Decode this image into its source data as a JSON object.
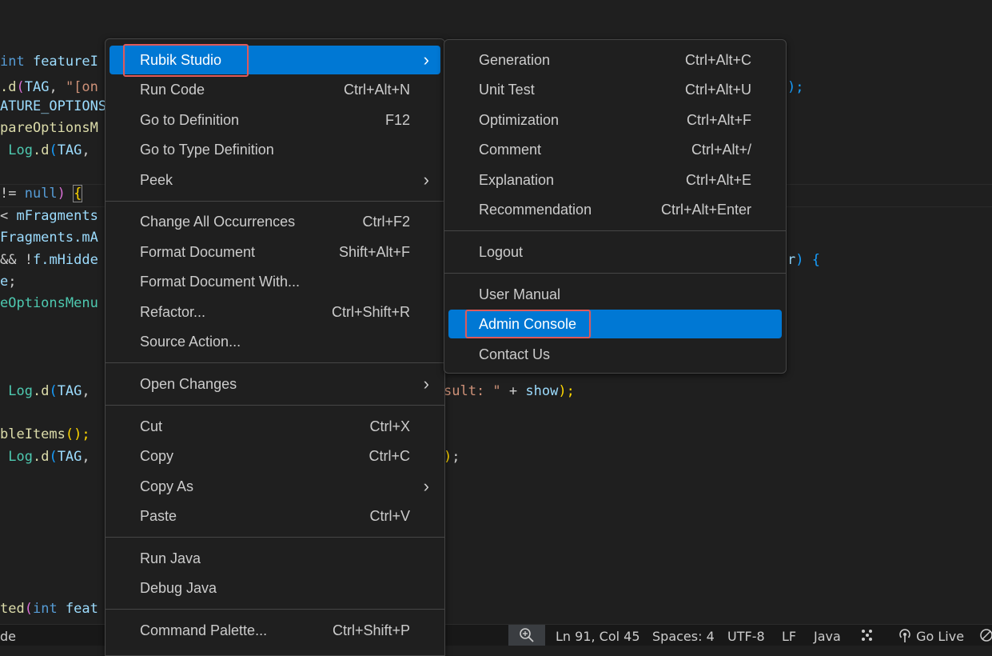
{
  "code": {
    "line1": [
      "int ",
      "featureI"
    ],
    "line2": [
      ".d",
      "(",
      "TAG",
      ", ",
      "\"[on"
    ],
    "line2_tail": ");",
    "line3": "ATURE_OPTIONS",
    "line4": "pareOptionsM",
    "line5": [
      " Log",
      ".d",
      "(",
      "TAG",
      ","
    ],
    "line6": [
      "!= ",
      "null",
      ") ",
      "{"
    ],
    "line7": [
      "< ",
      "mFragments"
    ],
    "line8": [
      "Fragments",
      ".mA"
    ],
    "line9": [
      "&& !",
      "f",
      ".mHidde"
    ],
    "line9_tail": [
      "r",
      ") ",
      "{"
    ],
    "line10": [
      "e",
      ";"
    ],
    "line11": "eOptionsMenu",
    "line12": [
      " Log",
      ".d",
      "(",
      "TAG",
      ","
    ],
    "line12_tail": [
      "sult: \"",
      " + ",
      "show",
      ");"
    ],
    "line13": [
      "bleItems",
      "();"
    ],
    "line14": [
      " Log",
      ".d",
      "(",
      "TAG",
      ","
    ],
    "line14_tail": [
      ")",
      ";"
    ],
    "line15": [
      "ted",
      "(",
      "int ",
      "feat"
    ],
    "line16": "de"
  },
  "main_menu": {
    "items": [
      {
        "label": "Rubik Studio",
        "shortcut": "",
        "submenu": true
      },
      {
        "label": "Run Code",
        "shortcut": "Ctrl+Alt+N"
      },
      {
        "label": "Go to Definition",
        "shortcut": "F12"
      },
      {
        "label": "Go to Type Definition",
        "shortcut": ""
      },
      {
        "label": "Peek",
        "shortcut": "",
        "submenu": true
      },
      {
        "label": "Change All Occurrences",
        "shortcut": "Ctrl+F2"
      },
      {
        "label": "Format Document",
        "shortcut": "Shift+Alt+F"
      },
      {
        "label": "Format Document With...",
        "shortcut": ""
      },
      {
        "label": "Refactor...",
        "shortcut": "Ctrl+Shift+R"
      },
      {
        "label": "Source Action...",
        "shortcut": ""
      },
      {
        "label": "Open Changes",
        "shortcut": "",
        "submenu": true
      },
      {
        "label": "Cut",
        "shortcut": "Ctrl+X"
      },
      {
        "label": "Copy",
        "shortcut": "Ctrl+C"
      },
      {
        "label": "Copy As",
        "shortcut": "",
        "submenu": true
      },
      {
        "label": "Paste",
        "shortcut": "Ctrl+V"
      },
      {
        "label": "Run Java",
        "shortcut": ""
      },
      {
        "label": "Debug Java",
        "shortcut": ""
      },
      {
        "label": "Command Palette...",
        "shortcut": "Ctrl+Shift+P"
      }
    ]
  },
  "sub_menu": {
    "items": [
      {
        "label": "Generation",
        "shortcut": "Ctrl+Alt+C"
      },
      {
        "label": "Unit Test",
        "shortcut": "Ctrl+Alt+U"
      },
      {
        "label": "Optimization",
        "shortcut": "Ctrl+Alt+F"
      },
      {
        "label": "Comment",
        "shortcut": "Ctrl+Alt+/"
      },
      {
        "label": "Explanation",
        "shortcut": "Ctrl+Alt+E"
      },
      {
        "label": "Recommendation",
        "shortcut": "Ctrl+Alt+Enter"
      },
      {
        "label": "Logout",
        "shortcut": ""
      },
      {
        "label": "User Manual",
        "shortcut": ""
      },
      {
        "label": "Admin Console",
        "shortcut": ""
      },
      {
        "label": "Contact Us",
        "shortcut": ""
      }
    ]
  },
  "status_bar": {
    "left_text": "de",
    "zoom_icon": "zoom-in-icon",
    "position": "Ln 91, Col 45",
    "spaces": "Spaces: 4",
    "encoding": "UTF-8",
    "eol": "LF",
    "language": "Java",
    "java_icon": "java-tools-icon",
    "go_live_icon": "broadcast-icon",
    "go_live": "Go Live",
    "notifications_icon": "no-bell-icon"
  },
  "colors": {
    "accent": "#0078d4",
    "highlight_border": "#e05a5a",
    "background": "#1f1f1f"
  }
}
